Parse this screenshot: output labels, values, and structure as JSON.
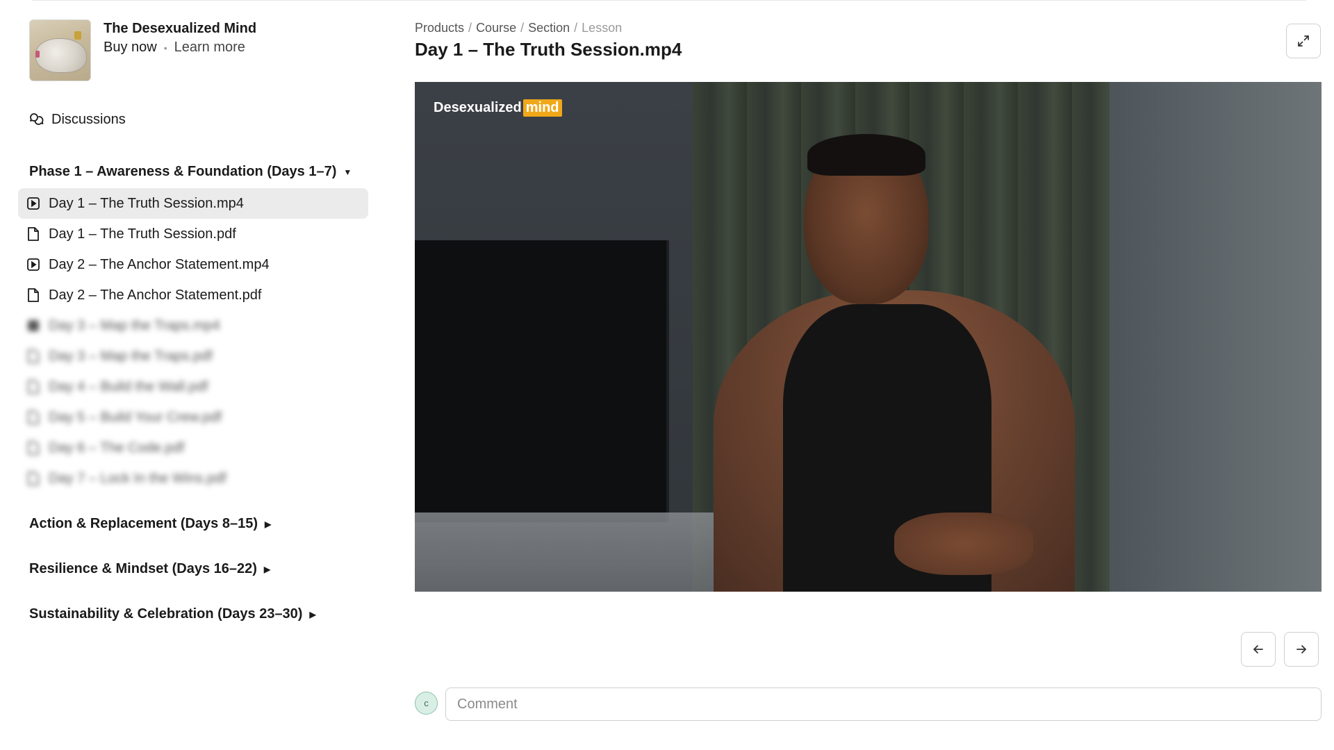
{
  "product": {
    "title": "The Desexualized Mind",
    "buy_label": "Buy now",
    "separator": "•",
    "learn_label": "Learn more"
  },
  "sidebar": {
    "discussions_label": "Discussions",
    "phases": [
      {
        "label": "Phase 1 – Awareness & Foundation (Days 1–7)",
        "caret": "▼",
        "expanded": true,
        "lessons": [
          {
            "label": "Day 1 – The Truth Session.mp4",
            "type": "video",
            "active": true
          },
          {
            "label": "Day 1 – The Truth Session.pdf",
            "type": "file",
            "active": false
          },
          {
            "label": "Day 2 – The Anchor Statement.mp4",
            "type": "video",
            "active": false
          },
          {
            "label": "Day 2 – The Anchor Statement.pdf",
            "type": "file",
            "active": false
          },
          {
            "label": "Day 3 – Map the Traps.mp4",
            "type": "video",
            "locked_blurred": true
          },
          {
            "label": "Day 3 – Map the Traps.pdf",
            "type": "file",
            "locked_blurred": true
          },
          {
            "label": "Day 4 – Build the Wall.pdf",
            "type": "file",
            "locked_blurred": true
          },
          {
            "label": "Day 5 – Build Your Crew.pdf",
            "type": "file",
            "locked_blurred": true
          },
          {
            "label": "Day 6 – The Code.pdf",
            "type": "file",
            "locked_blurred": true
          },
          {
            "label": "Day 7 – Lock In the Wins.pdf",
            "type": "file",
            "locked_blurred": true
          }
        ]
      },
      {
        "label": "Action & Replacement (Days 8–15)",
        "caret": "▶",
        "expanded": false
      },
      {
        "label": "Resilience & Mindset (Days 16–22)",
        "caret": "▶",
        "expanded": false
      },
      {
        "label": "Sustainability & Celebration (Days 23–30)",
        "caret": "▶",
        "expanded": false
      }
    ]
  },
  "breadcrumb": {
    "items": [
      "Products",
      "Course",
      "Section"
    ],
    "separator": "/",
    "current": "Lesson"
  },
  "lesson": {
    "title": "Day 1 – The Truth Session.mp4"
  },
  "video": {
    "logo_text": "Desexualized",
    "logo_highlight": "mind",
    "accent_color": "#f0a81a"
  },
  "navigation": {
    "prev_icon": "arrow-left-icon",
    "next_icon": "arrow-right-icon"
  },
  "comment": {
    "avatar_initial": "c",
    "placeholder": "Comment"
  },
  "colors": {
    "active_item_bg": "#ebebeb",
    "avatar_bg": "#d9efe6",
    "border": "#cfcfcf"
  }
}
